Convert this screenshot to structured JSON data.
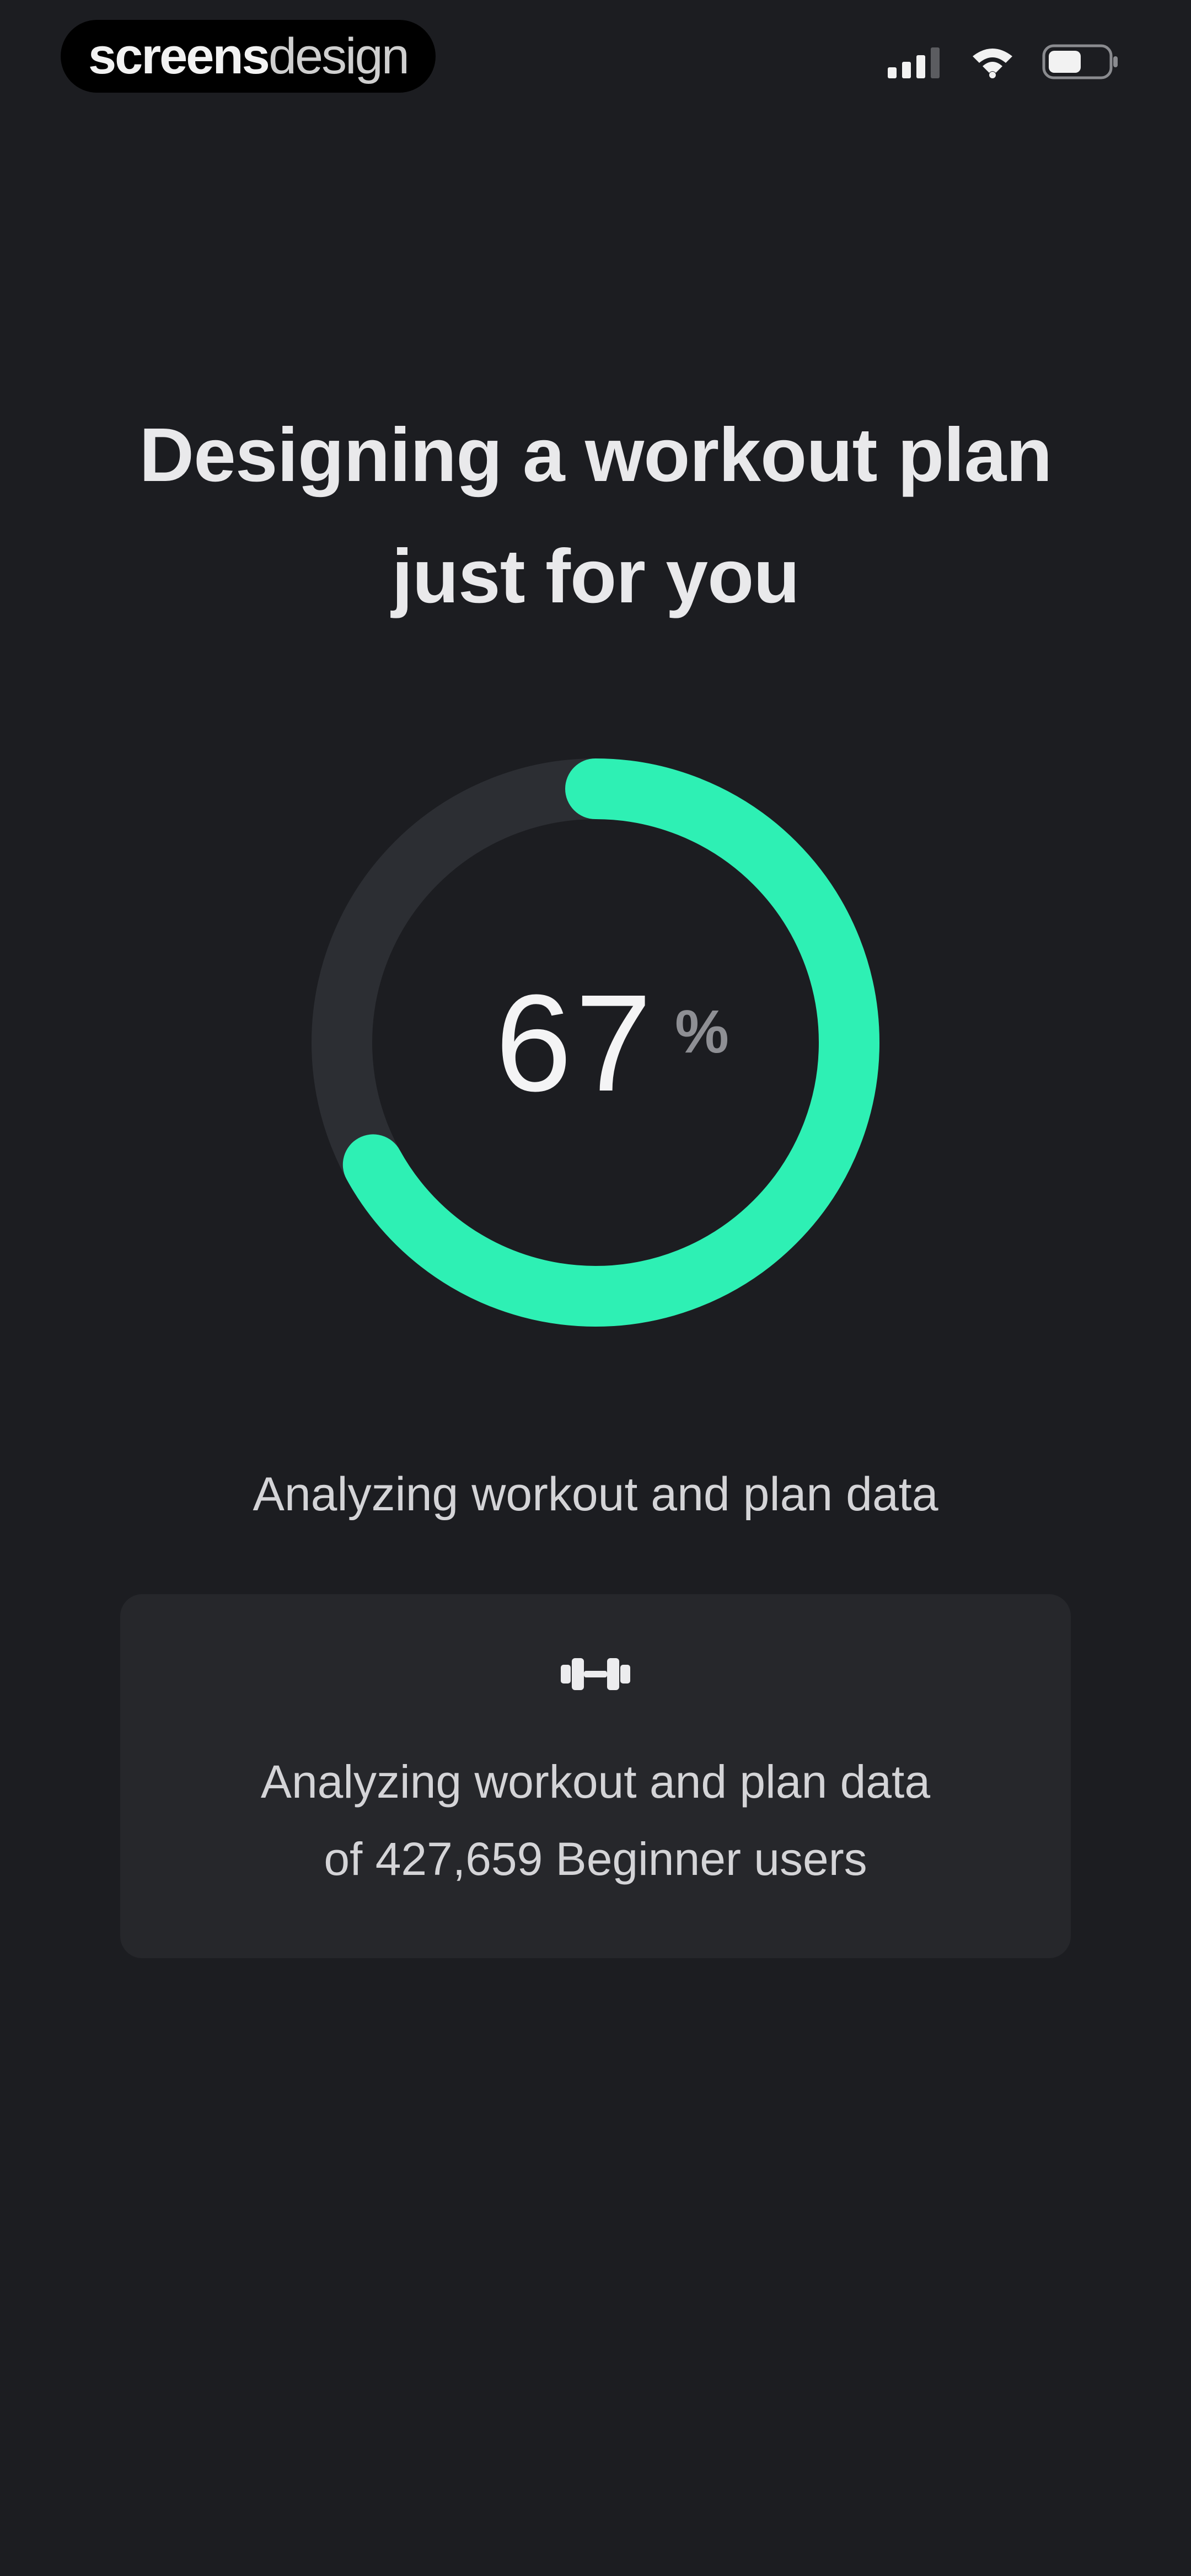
{
  "status_bar": {
    "brand_strong": "screens",
    "brand_light": "design",
    "icons": [
      "cellular-signal-icon",
      "wifi-icon",
      "battery-icon"
    ]
  },
  "main": {
    "title_line1": "Designing a workout plan",
    "title_line2": "just for you",
    "progress": {
      "value": "67",
      "unit": "%",
      "fraction": 0.67
    },
    "caption": "Analyzing workout and plan data",
    "card": {
      "icon": "dumbbell-icon",
      "line1": "Analyzing workout and plan data",
      "line2": "of 427,659 Beginner users"
    }
  },
  "colors": {
    "background": "#1c1d21",
    "accent": "#2ef0b4",
    "track": "#2c2e33",
    "card": "#26272b"
  }
}
